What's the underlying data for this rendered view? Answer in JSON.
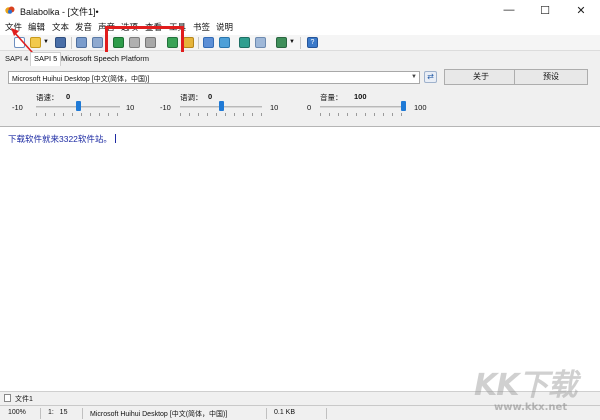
{
  "window": {
    "title": "Balabolka - [文件1]•",
    "minimize_glyph": "—",
    "maximize_glyph": "☐",
    "close_glyph": "✕"
  },
  "menu": [
    "文件",
    "编辑",
    "文本",
    "发音",
    "声音",
    "选项",
    "查看",
    "工具",
    "书签",
    "说明"
  ],
  "toolbar": {
    "icons": [
      "new-document-icon",
      "open-folder-icon",
      "dropdown-arrow-icon",
      "save-icon",
      "print-icon",
      "clipboard-read-icon",
      "play-icon",
      "pause-icon",
      "stop-icon",
      "read-clipboard-icon",
      "open-file-icon",
      "text-view-icon",
      "voice-settings-icon",
      "save-audio-icon",
      "split-file-icon",
      "batch-convert-icon",
      "help-icon"
    ],
    "highlight_color": "#e11d1d"
  },
  "engine_tabs": [
    "SAPI 4",
    "SAPI 5",
    "Microsoft Speech Platform"
  ],
  "voice": {
    "selected": "Microsoft Huihui Desktop [中文(简体，中国)]"
  },
  "buttons": {
    "about": "关于",
    "preset": "预设"
  },
  "sliders": {
    "rate": {
      "label": "语速：",
      "value": "0",
      "min": "-10",
      "max": "10",
      "fraction": 0.5
    },
    "pitch": {
      "label": "语调：",
      "value": "0",
      "min": "-10",
      "max": "10",
      "fraction": 0.5
    },
    "volume": {
      "label": "音量：",
      "value": "100",
      "min": "0",
      "max": "100",
      "fraction": 1.0
    }
  },
  "editor": {
    "text": "下载软件就来3322软件站。",
    "text_color": "#1d2ba3"
  },
  "document_tabs": [
    "文件1"
  ],
  "status_bar": {
    "zoom": "100%",
    "position": "1:   15",
    "voice": "Microsoft Huihui Desktop [中文(简体，中国)]",
    "size": "0.1 KB"
  },
  "watermark": {
    "text": "KK下载",
    "url": "www.kkx.net"
  }
}
